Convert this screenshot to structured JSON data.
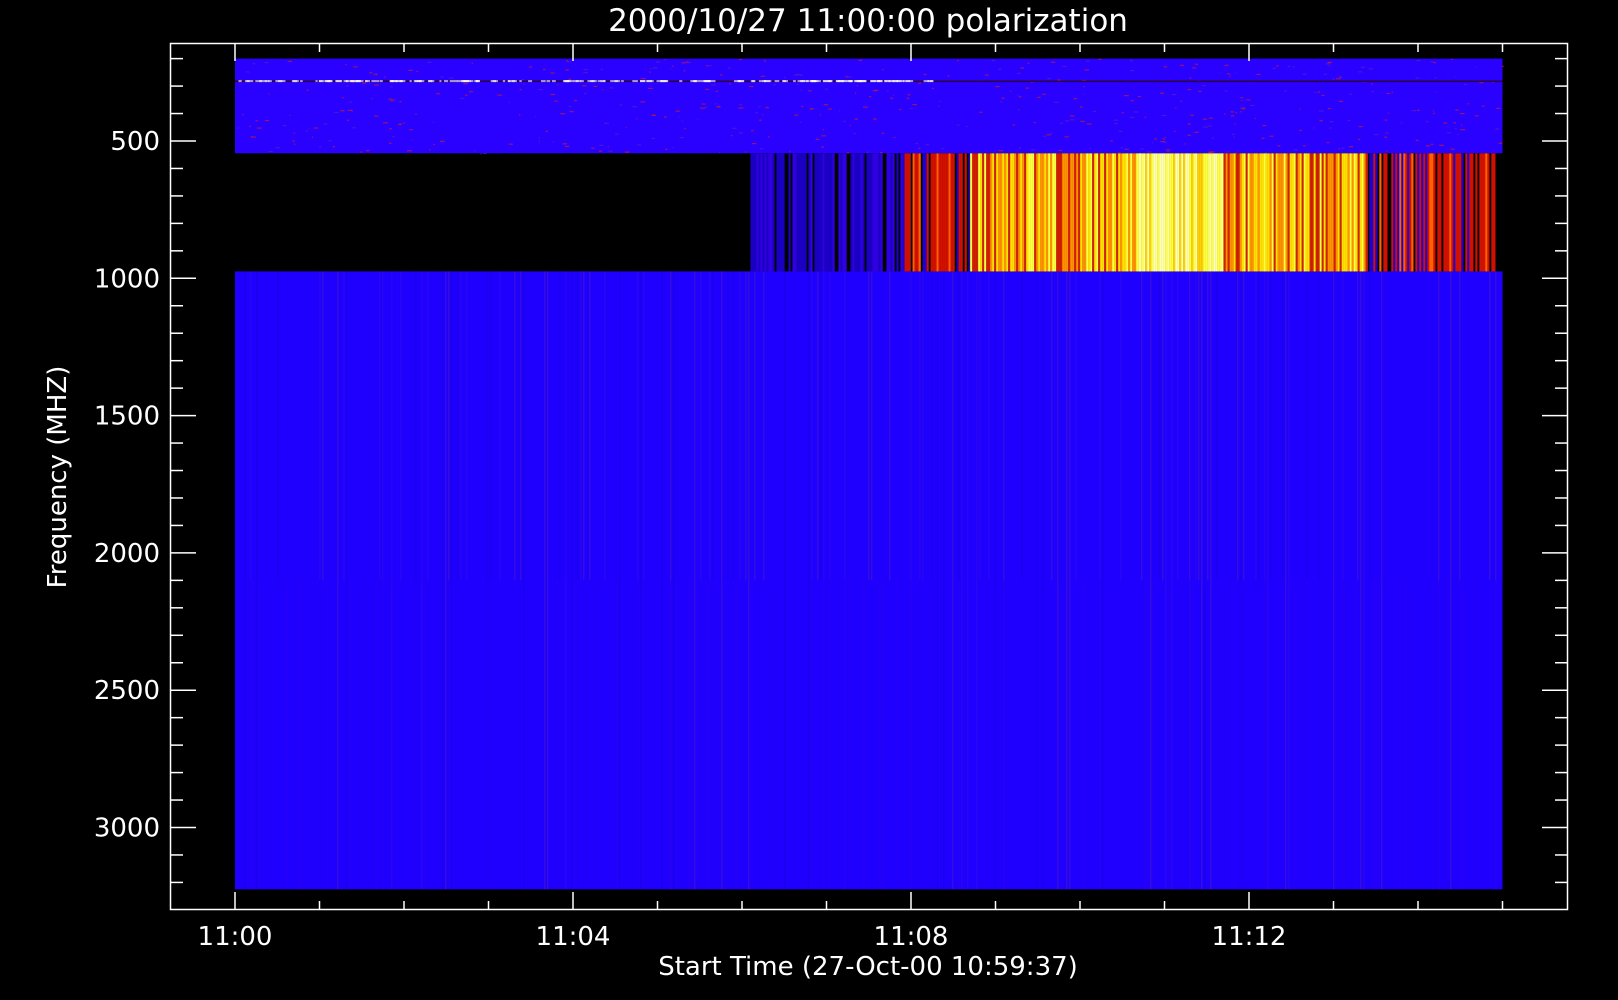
{
  "chart_data": {
    "type": "heatmap",
    "title": "2000/10/27 11:00:00 polarization",
    "xlabel": "Start Time (27-Oct-00 10:59:37)",
    "ylabel": "Frequency (MHZ)",
    "xlim_minutes_after_11_00": [
      -0.77,
      15.77
    ],
    "ylim_mhz": [
      3250,
      200
    ],
    "y_reversed": true,
    "x_ticks": [
      {
        "label": "11:00",
        "minute": 0
      },
      {
        "label": "11:04",
        "minute": 4
      },
      {
        "label": "11:08",
        "minute": 8
      },
      {
        "label": "11:12",
        "minute": 12
      }
    ],
    "x_minor_step_minutes": 1,
    "y_ticks": [
      {
        "label": "500",
        "value": 500
      },
      {
        "label": "1000",
        "value": 1000
      },
      {
        "label": "1500",
        "value": 1500
      },
      {
        "label": "2000",
        "value": 2000
      },
      {
        "label": "2500",
        "value": 2500
      },
      {
        "label": "3000",
        "value": 3000
      }
    ],
    "y_minor_step_mhz": 100,
    "bands": [
      {
        "name": "low",
        "freq_range_mhz": [
          200,
          545
        ],
        "time_range_minutes": [
          0,
          15
        ],
        "base_color": "#2a00ff",
        "speckle_color": "#c81e32"
      },
      {
        "name": "mid",
        "freq_range_mhz": [
          545,
          975
        ],
        "time_range_minutes": [
          0,
          15
        ],
        "base_color": "#000000"
      },
      {
        "name": "high",
        "freq_range_mhz": [
          975,
          3225
        ],
        "time_range_minutes": [
          0,
          15
        ],
        "base_color": "#1f00ff"
      }
    ],
    "mid_band_activity": [
      {
        "time_range_minutes": [
          6.1,
          7.9
        ],
        "level": "weak"
      },
      {
        "time_range_minutes": [
          7.9,
          8.7
        ],
        "level": "moderate"
      },
      {
        "time_range_minutes": [
          8.7,
          10.7
        ],
        "level": "strong"
      },
      {
        "time_range_minutes": [
          10.7,
          11.7
        ],
        "level": "very-strong"
      },
      {
        "time_range_minutes": [
          11.7,
          13.4
        ],
        "level": "strong"
      },
      {
        "time_range_minutes": [
          13.4,
          14.9
        ],
        "level": "moderate"
      }
    ],
    "colors": {
      "background": "#000000",
      "axis": "#ffffff",
      "text": "#ffffff",
      "blue": "#2000ff",
      "red": "#e01000",
      "orange": "#ff8000",
      "yellow": "#ffff00",
      "white_yellow": "#ffffc0"
    }
  }
}
